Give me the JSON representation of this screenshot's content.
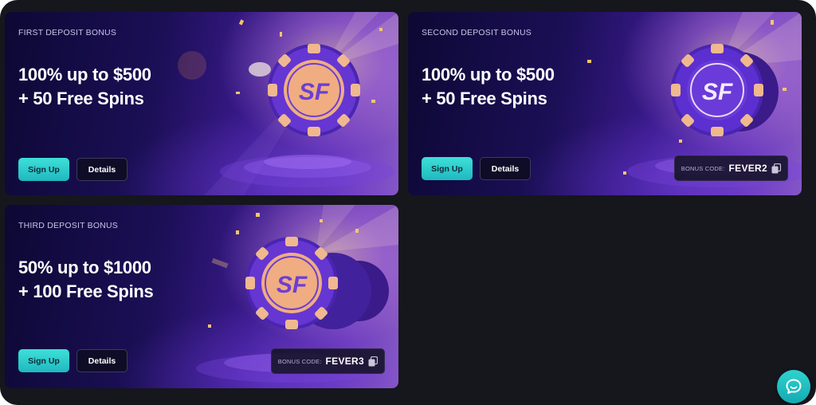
{
  "promotions": [
    {
      "label": "FIRST DEPOSIT BONUS",
      "title_line1": "100% up to $500",
      "title_line2": "+ 50 Free Spins",
      "signup_label": "Sign Up",
      "details_label": "Details",
      "chip_logo": "SF"
    },
    {
      "label": "SECOND DEPOSIT BONUS",
      "title_line1": "100% up to $500",
      "title_line2": "+ 50 Free Spins",
      "signup_label": "Sign Up",
      "details_label": "Details",
      "bonus_code_label": "BONUS CODE:",
      "bonus_code": "FEVER2",
      "chip_logo": "SF"
    },
    {
      "label": "THIRD DEPOSIT BONUS",
      "title_line1": "50% up to $1000",
      "title_line2": "+ 100 Free Spins",
      "signup_label": "Sign Up",
      "details_label": "Details",
      "bonus_code_label": "BONUS CODE:",
      "bonus_code": "FEVER3",
      "chip_logo": "SF"
    }
  ],
  "chat": {
    "icon": "chat-bubble-icon"
  },
  "colors": {
    "background": "#16161d",
    "signup_button": "#2ccbcc",
    "chip_purple": "#5a2fc4",
    "chip_gold": "#e8b48a"
  }
}
